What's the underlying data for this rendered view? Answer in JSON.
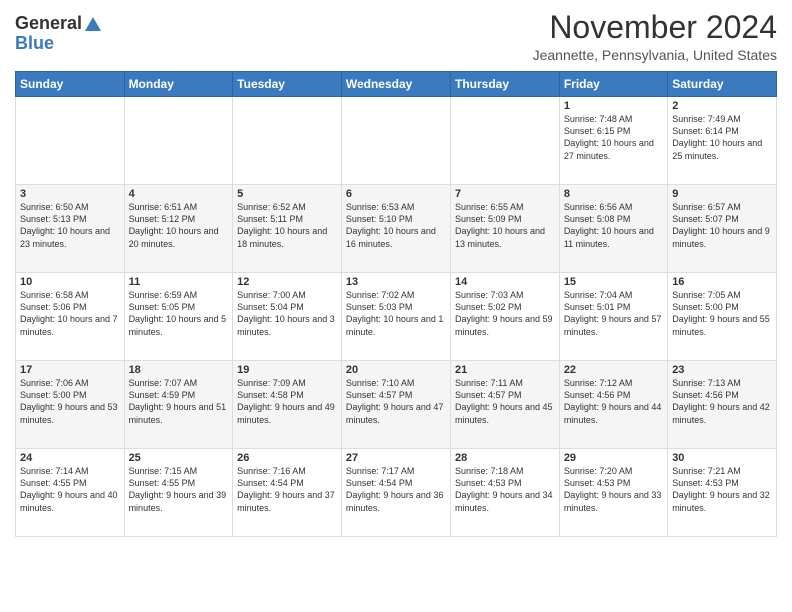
{
  "header": {
    "logo_general": "General",
    "logo_blue": "Blue",
    "month_title": "November 2024",
    "location": "Jeannette, Pennsylvania, United States"
  },
  "calendar": {
    "days_of_week": [
      "Sunday",
      "Monday",
      "Tuesday",
      "Wednesday",
      "Thursday",
      "Friday",
      "Saturday"
    ],
    "weeks": [
      [
        {
          "day": "",
          "info": ""
        },
        {
          "day": "",
          "info": ""
        },
        {
          "day": "",
          "info": ""
        },
        {
          "day": "",
          "info": ""
        },
        {
          "day": "",
          "info": ""
        },
        {
          "day": "1",
          "info": "Sunrise: 7:48 AM\nSunset: 6:15 PM\nDaylight: 10 hours and 27 minutes."
        },
        {
          "day": "2",
          "info": "Sunrise: 7:49 AM\nSunset: 6:14 PM\nDaylight: 10 hours and 25 minutes."
        }
      ],
      [
        {
          "day": "3",
          "info": "Sunrise: 6:50 AM\nSunset: 5:13 PM\nDaylight: 10 hours and 23 minutes."
        },
        {
          "day": "4",
          "info": "Sunrise: 6:51 AM\nSunset: 5:12 PM\nDaylight: 10 hours and 20 minutes."
        },
        {
          "day": "5",
          "info": "Sunrise: 6:52 AM\nSunset: 5:11 PM\nDaylight: 10 hours and 18 minutes."
        },
        {
          "day": "6",
          "info": "Sunrise: 6:53 AM\nSunset: 5:10 PM\nDaylight: 10 hours and 16 minutes."
        },
        {
          "day": "7",
          "info": "Sunrise: 6:55 AM\nSunset: 5:09 PM\nDaylight: 10 hours and 13 minutes."
        },
        {
          "day": "8",
          "info": "Sunrise: 6:56 AM\nSunset: 5:08 PM\nDaylight: 10 hours and 11 minutes."
        },
        {
          "day": "9",
          "info": "Sunrise: 6:57 AM\nSunset: 5:07 PM\nDaylight: 10 hours and 9 minutes."
        }
      ],
      [
        {
          "day": "10",
          "info": "Sunrise: 6:58 AM\nSunset: 5:06 PM\nDaylight: 10 hours and 7 minutes."
        },
        {
          "day": "11",
          "info": "Sunrise: 6:59 AM\nSunset: 5:05 PM\nDaylight: 10 hours and 5 minutes."
        },
        {
          "day": "12",
          "info": "Sunrise: 7:00 AM\nSunset: 5:04 PM\nDaylight: 10 hours and 3 minutes."
        },
        {
          "day": "13",
          "info": "Sunrise: 7:02 AM\nSunset: 5:03 PM\nDaylight: 10 hours and 1 minute."
        },
        {
          "day": "14",
          "info": "Sunrise: 7:03 AM\nSunset: 5:02 PM\nDaylight: 9 hours and 59 minutes."
        },
        {
          "day": "15",
          "info": "Sunrise: 7:04 AM\nSunset: 5:01 PM\nDaylight: 9 hours and 57 minutes."
        },
        {
          "day": "16",
          "info": "Sunrise: 7:05 AM\nSunset: 5:00 PM\nDaylight: 9 hours and 55 minutes."
        }
      ],
      [
        {
          "day": "17",
          "info": "Sunrise: 7:06 AM\nSunset: 5:00 PM\nDaylight: 9 hours and 53 minutes."
        },
        {
          "day": "18",
          "info": "Sunrise: 7:07 AM\nSunset: 4:59 PM\nDaylight: 9 hours and 51 minutes."
        },
        {
          "day": "19",
          "info": "Sunrise: 7:09 AM\nSunset: 4:58 PM\nDaylight: 9 hours and 49 minutes."
        },
        {
          "day": "20",
          "info": "Sunrise: 7:10 AM\nSunset: 4:57 PM\nDaylight: 9 hours and 47 minutes."
        },
        {
          "day": "21",
          "info": "Sunrise: 7:11 AM\nSunset: 4:57 PM\nDaylight: 9 hours and 45 minutes."
        },
        {
          "day": "22",
          "info": "Sunrise: 7:12 AM\nSunset: 4:56 PM\nDaylight: 9 hours and 44 minutes."
        },
        {
          "day": "23",
          "info": "Sunrise: 7:13 AM\nSunset: 4:56 PM\nDaylight: 9 hours and 42 minutes."
        }
      ],
      [
        {
          "day": "24",
          "info": "Sunrise: 7:14 AM\nSunset: 4:55 PM\nDaylight: 9 hours and 40 minutes."
        },
        {
          "day": "25",
          "info": "Sunrise: 7:15 AM\nSunset: 4:55 PM\nDaylight: 9 hours and 39 minutes."
        },
        {
          "day": "26",
          "info": "Sunrise: 7:16 AM\nSunset: 4:54 PM\nDaylight: 9 hours and 37 minutes."
        },
        {
          "day": "27",
          "info": "Sunrise: 7:17 AM\nSunset: 4:54 PM\nDaylight: 9 hours and 36 minutes."
        },
        {
          "day": "28",
          "info": "Sunrise: 7:18 AM\nSunset: 4:53 PM\nDaylight: 9 hours and 34 minutes."
        },
        {
          "day": "29",
          "info": "Sunrise: 7:20 AM\nSunset: 4:53 PM\nDaylight: 9 hours and 33 minutes."
        },
        {
          "day": "30",
          "info": "Sunrise: 7:21 AM\nSunset: 4:53 PM\nDaylight: 9 hours and 32 minutes."
        }
      ]
    ]
  }
}
